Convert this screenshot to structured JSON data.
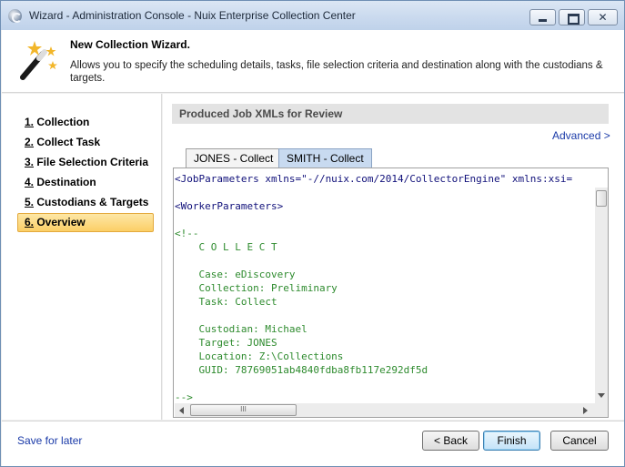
{
  "window": {
    "title": "Wizard - Administration Console - Nuix Enterprise Collection Center",
    "close_glyph": "✕"
  },
  "header": {
    "title": "New Collection Wizard.",
    "description": "Allows you to specify the scheduling details, tasks, file selection criteria and destination along with the custodians & targets."
  },
  "nav": {
    "items": [
      {
        "num": "1.",
        "label": " Collection",
        "active": false
      },
      {
        "num": "2.",
        "label": " Collect Task",
        "active": false
      },
      {
        "num": "3.",
        "label": " File Selection Criteria",
        "active": false
      },
      {
        "num": "4.",
        "label": " Destination",
        "active": false
      },
      {
        "num": "5.",
        "label": " Custodians & Targets",
        "active": false
      },
      {
        "num": "6.",
        "label": " Overview",
        "active": true
      }
    ]
  },
  "main": {
    "section_title": "Produced Job XMLs for Review",
    "advanced_link": "Advanced >",
    "tabs": [
      {
        "label": "JONES - Collect",
        "active": true
      },
      {
        "label": "SMITH - Collect",
        "active": false
      }
    ],
    "code_lines": [
      {
        "text": "<JobParameters xmlns=\"-//nuix.com/2014/CollectorEngine\" xmlns:xsi=",
        "kind": "tag"
      },
      {
        "text": "",
        "kind": "tag"
      },
      {
        "text": "<WorkerParameters>",
        "kind": "tag"
      },
      {
        "text": "",
        "kind": "tag"
      },
      {
        "text": "<!--",
        "kind": "comment"
      },
      {
        "text": "    C O L L E C T",
        "kind": "comment"
      },
      {
        "text": "",
        "kind": "comment"
      },
      {
        "text": "    Case: eDiscovery",
        "kind": "comment"
      },
      {
        "text": "    Collection: Preliminary",
        "kind": "comment"
      },
      {
        "text": "    Task: Collect",
        "kind": "comment"
      },
      {
        "text": "",
        "kind": "comment"
      },
      {
        "text": "    Custodian: Michael",
        "kind": "comment"
      },
      {
        "text": "    Target: JONES",
        "kind": "comment"
      },
      {
        "text": "    Location: Z:\\Collections",
        "kind": "comment"
      },
      {
        "text": "    GUID: 78769051ab4840fdba8fb117e292df5d",
        "kind": "comment"
      },
      {
        "text": "",
        "kind": "comment"
      },
      {
        "text": "-->",
        "kind": "comment"
      }
    ],
    "hscroll_thumb_grip": "III"
  },
  "footer": {
    "save_for_later": "Save for later",
    "back_label": "< Back",
    "finish_label": "Finish",
    "cancel_label": "Cancel"
  },
  "colors": {
    "tag": "#10107a",
    "comment": "#2e8b2e",
    "nav_active": "#fbcf66",
    "link": "#1a3aa8"
  }
}
